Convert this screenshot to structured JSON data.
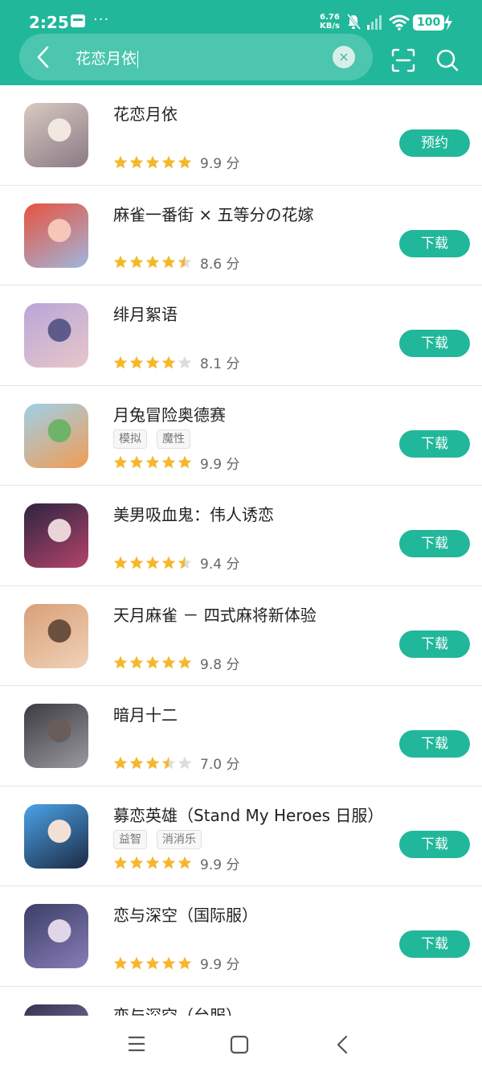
{
  "status_bar": {
    "time": "2:25",
    "net_speed_value": "6.76",
    "net_speed_unit": "KB/s",
    "battery": "100"
  },
  "search": {
    "query": "花恋月依"
  },
  "colors": {
    "accent": "#21b79a",
    "star": "#f6b72a",
    "star_empty": "#dddddd"
  },
  "apps": [
    {
      "title": "花恋月依",
      "tags": [],
      "rating": 5,
      "score": "9.9 分",
      "button": "预约"
    },
    {
      "title": "麻雀一番街 × 五等分の花嫁",
      "tags": [],
      "rating": 4.5,
      "score": "8.6 分",
      "button": "下载"
    },
    {
      "title": "绯月絮语",
      "tags": [],
      "rating": 4,
      "score": "8.1 分",
      "button": "下载"
    },
    {
      "title": "月兔冒险奥德赛",
      "tags": [
        "模拟",
        "魔性"
      ],
      "rating": 5,
      "score": "9.9 分",
      "button": "下载"
    },
    {
      "title": "美男吸血鬼：伟人诱恋",
      "tags": [],
      "rating": 4.5,
      "score": "9.4 分",
      "button": "下载"
    },
    {
      "title": "天月麻雀 － 四式麻将新体验",
      "tags": [],
      "rating": 5,
      "score": "9.8 分",
      "button": "下载"
    },
    {
      "title": "暗月十二",
      "tags": [],
      "rating": 3.5,
      "score": "7.0 分",
      "button": "下载"
    },
    {
      "title": "募恋英雄（Stand My Heroes 日服）",
      "tags": [
        "益智",
        "消消乐"
      ],
      "rating": 5,
      "score": "9.9 分",
      "button": "下载"
    },
    {
      "title": "恋与深空（国际服）",
      "tags": [],
      "rating": 5,
      "score": "9.9 分",
      "button": "下载"
    },
    {
      "title": "恋与深空（台服）",
      "tags": [],
      "rating": null,
      "score": "",
      "button": ""
    }
  ]
}
